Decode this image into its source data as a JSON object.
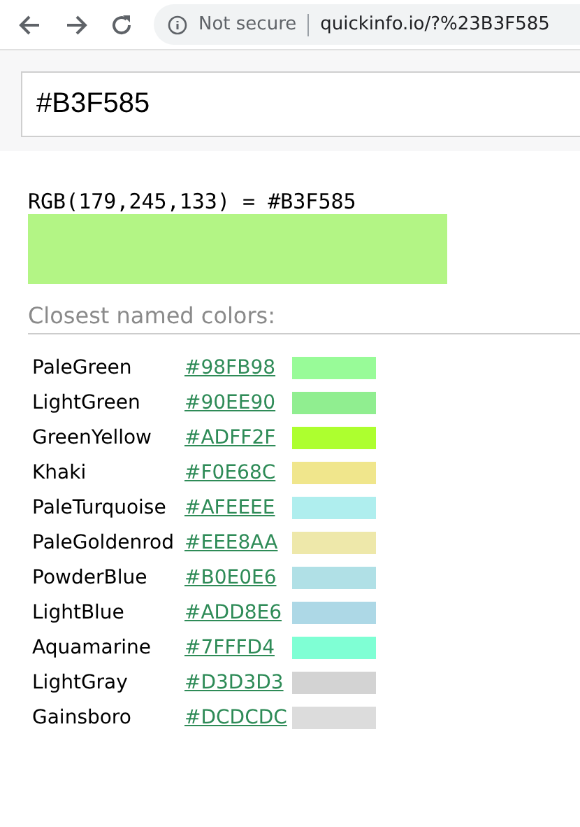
{
  "browser": {
    "security": "Not secure",
    "url": "quickinfo.io/?%23B3F585"
  },
  "search": {
    "value": "#B3F585"
  },
  "result": {
    "heading": "RGB(179,245,133) = #B3F585",
    "color": "#b3f585"
  },
  "closest": {
    "title": "Closest named colors:",
    "colors": [
      {
        "name": "PaleGreen",
        "hex": "#98FB98",
        "color": "#98fb98"
      },
      {
        "name": "LightGreen",
        "hex": "#90EE90",
        "color": "#90ee90"
      },
      {
        "name": "GreenYellow",
        "hex": "#ADFF2F",
        "color": "#adff2f"
      },
      {
        "name": "Khaki",
        "hex": "#F0E68C",
        "color": "#f0e68c"
      },
      {
        "name": "PaleTurquoise",
        "hex": "#AFEEEE",
        "color": "#afeeee"
      },
      {
        "name": "PaleGoldenrod",
        "hex": "#EEE8AA",
        "color": "#eee8aa"
      },
      {
        "name": "PowderBlue",
        "hex": "#B0E0E6",
        "color": "#b0e0e6"
      },
      {
        "name": "LightBlue",
        "hex": "#ADD8E6",
        "color": "#add8e6"
      },
      {
        "name": "Aquamarine",
        "hex": "#7FFFD4",
        "color": "#7fffd4"
      },
      {
        "name": "LightGray",
        "hex": "#D3D3D3",
        "color": "#d3d3d3"
      },
      {
        "name": "Gainsboro",
        "hex": "#DCDCDC",
        "color": "#dcdcdc"
      }
    ]
  }
}
